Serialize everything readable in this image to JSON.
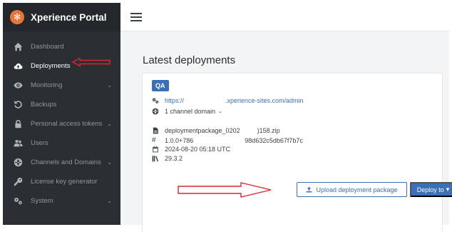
{
  "brand": {
    "name": "Xperience Portal",
    "logo_icon": "gear-flower-icon"
  },
  "sidebar": {
    "items": [
      {
        "label": "Dashboard",
        "icon": "home-icon",
        "chevron": ""
      },
      {
        "label": "Deployments",
        "icon": "cloud-upload-icon",
        "chevron": ""
      },
      {
        "label": "Monitoring",
        "icon": "eye-icon",
        "chevron": "⌄"
      },
      {
        "label": "Backups",
        "icon": "restore-icon",
        "chevron": ""
      },
      {
        "label": "Personal access tokens",
        "icon": "lock-icon",
        "chevron": "⌄"
      },
      {
        "label": "Users",
        "icon": "users-icon",
        "chevron": ""
      },
      {
        "label": "Channels and Domains",
        "icon": "globe-icon",
        "chevron": "⌄"
      },
      {
        "label": "License key generator",
        "icon": "key-icon",
        "chevron": ""
      },
      {
        "label": "System",
        "icon": "gears-icon",
        "chevron": "⌄"
      }
    ]
  },
  "main": {
    "title": "Latest deployments",
    "card": {
      "environment": "QA",
      "url_start": "https://",
      "url_end": ".xperience-sites.com/admin",
      "channels": "1 channel domain",
      "channels_chevron": "⌄",
      "package_start": "deploymentpackage_0202",
      "package_end": ")158.zip",
      "version": "1.0.0+786",
      "hash": "98d632c5db67f7b7c",
      "date": "2024-08-20 05:18 UTC",
      "build": "29.3.2",
      "upload_label": "Upload deployment package",
      "deploy_label": "Deploy to",
      "deploy_chevron": "▾"
    }
  },
  "colors": {
    "accent": "#3b6fb8",
    "sidebar": "#2b2f33",
    "brand_logo": "#e8763a",
    "annotation_arrow": "#d9272e"
  }
}
